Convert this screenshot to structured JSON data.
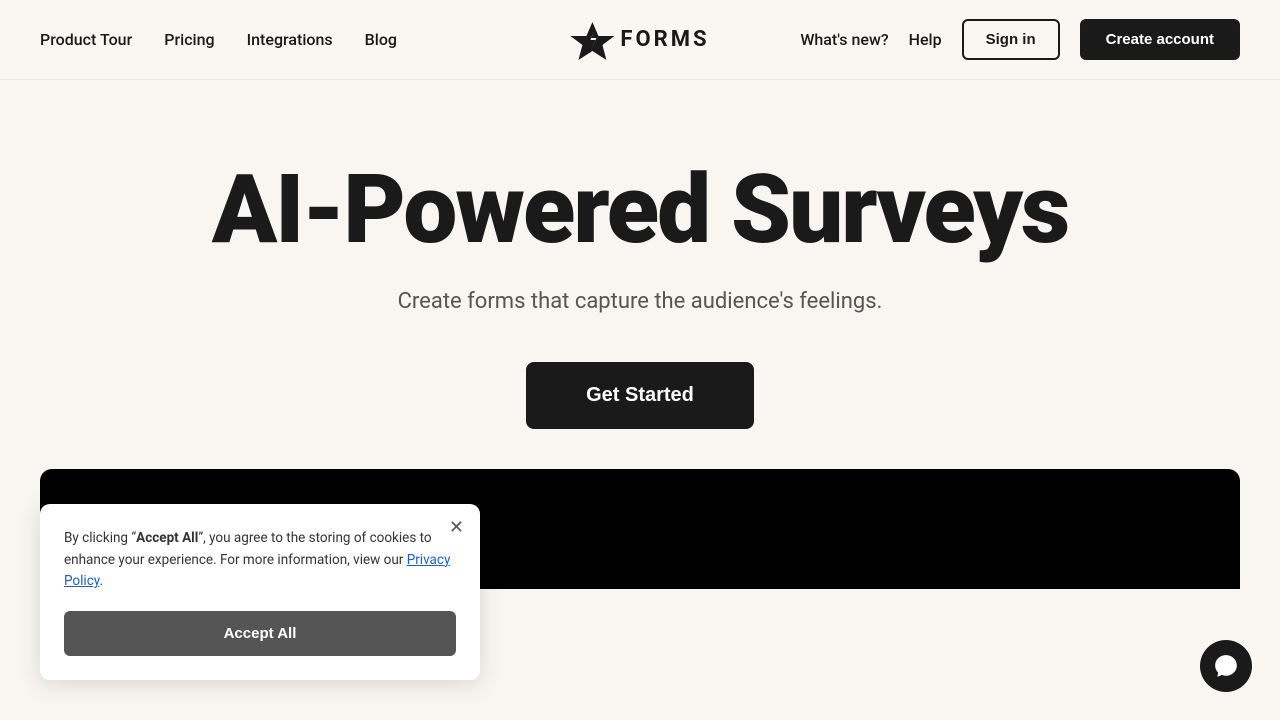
{
  "nav": {
    "links": [
      {
        "id": "product-tour",
        "label": "Product Tour"
      },
      {
        "id": "pricing",
        "label": "Pricing"
      },
      {
        "id": "integrations",
        "label": "Integrations"
      },
      {
        "id": "blog",
        "label": "Blog"
      }
    ],
    "logo_text": "FORMS",
    "right_links": [
      {
        "id": "whats-new",
        "label": "What's new?"
      },
      {
        "id": "help",
        "label": "Help"
      }
    ],
    "signin_label": "Sign in",
    "create_account_label": "Create account"
  },
  "hero": {
    "title": "AI-Powered Surveys",
    "subtitle": "Create forms that capture the audience's feelings.",
    "cta_label": "Get Started"
  },
  "cookie": {
    "text_before_bold": "By clicking “",
    "bold_text": "Accept All",
    "text_after_bold": "”, you agree to the storing of cookies to enhance your experience. For more information, view our",
    "privacy_link_label": "Privacy Policy",
    "period": ".",
    "accept_label": "Accept All"
  }
}
